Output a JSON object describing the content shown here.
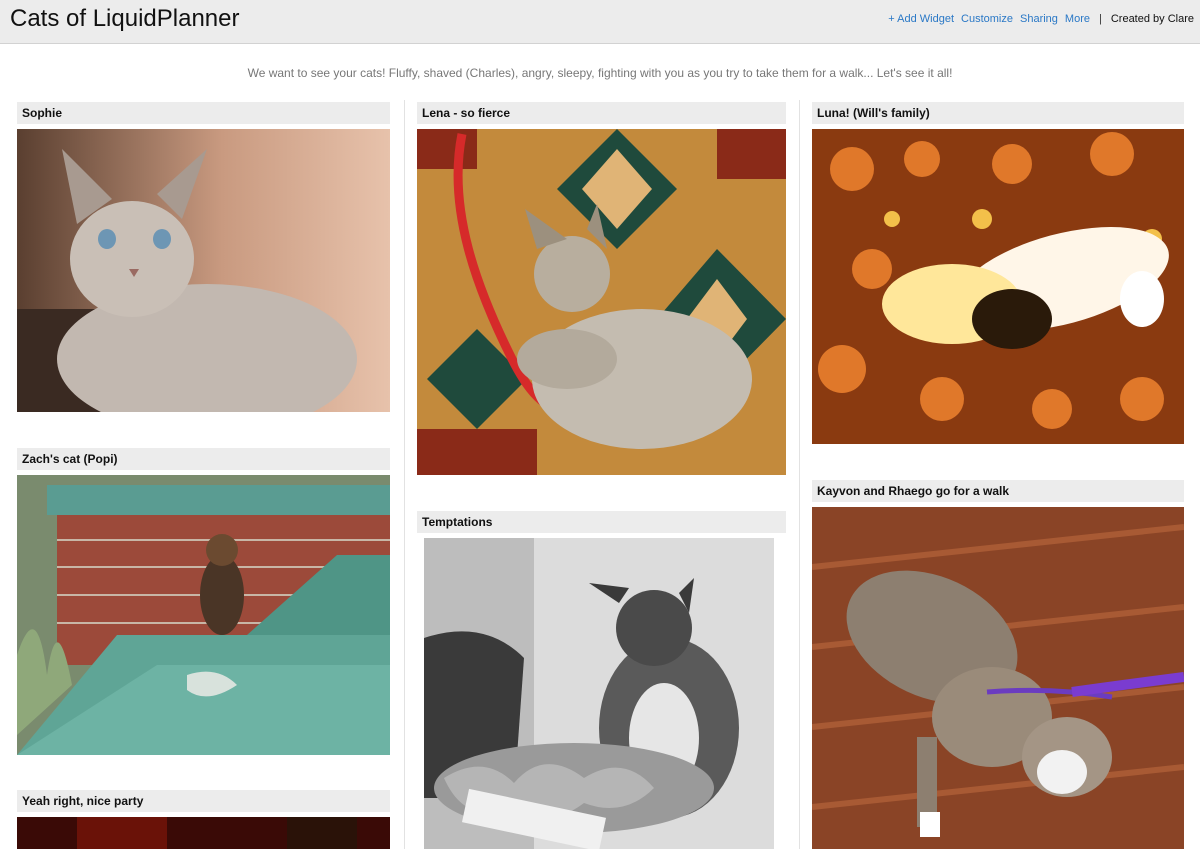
{
  "header": {
    "title": "Cats of LiquidPlanner",
    "add_widget": "+ Add Widget",
    "customize": "Customize",
    "sharing": "Sharing",
    "more": "More",
    "separator": "|",
    "created_by": "Created by Clare"
  },
  "intro": "We want to see your cats! Fluffy, shaved (Charles), angry, sleepy, fighting with you as you try to take them for a walk... Let's see it all!",
  "widgets": {
    "sophie": "Sophie",
    "zach": "Zach's cat (Popi)",
    "yeah": "Yeah right, nice party",
    "lena": "Lena - so fierce",
    "temptations": "Temptations",
    "luna": "Luna! (Will's family)",
    "kayvon": "Kayvon and Rhaego go for a walk"
  }
}
